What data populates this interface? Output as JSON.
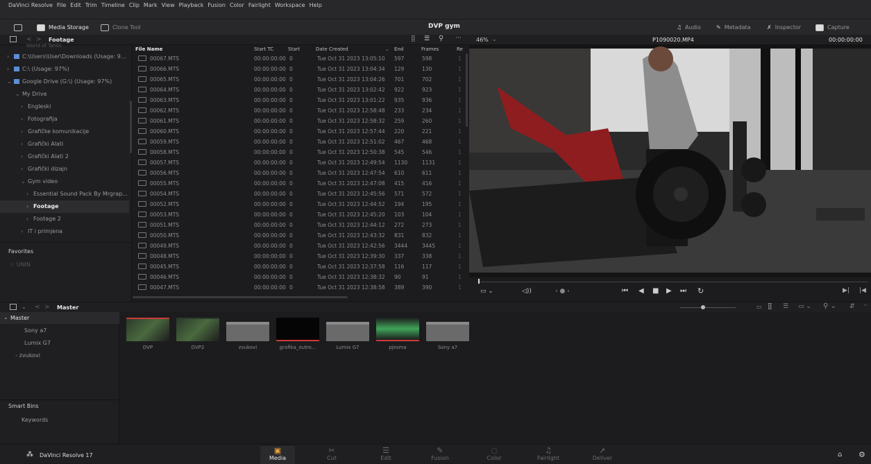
{
  "menu": [
    "DaVinci Resolve",
    "File",
    "Edit",
    "Trim",
    "Timeline",
    "Clip",
    "Mark",
    "View",
    "Playback",
    "Fusion",
    "Color",
    "Fairlight",
    "Workspace",
    "Help"
  ],
  "toolbar": {
    "media_storage": "Media Storage",
    "clone_tool": "Clone Tool",
    "project_title": "DVP gym",
    "audio": "Audio",
    "metadata": "Metadata",
    "inspector": "Inspector",
    "capture": "Capture"
  },
  "storage": {
    "folder": "Footage",
    "zoom": "46%",
    "clip_name": "P1090020.MP4",
    "timecode": "00:00:00:00"
  },
  "tree": {
    "truncated_top": "World of Tanks",
    "items": [
      {
        "label": "C:\\Users\\User\\Downloads (Usage: 9...",
        "drive": true
      },
      {
        "label": "C:\\ (Usage: 97%)",
        "drive": true
      },
      {
        "label": "Google Drive (G:\\) (Usage: 97%)",
        "drive": true
      },
      {
        "label": "My Drive"
      },
      {
        "label": "Engleski"
      },
      {
        "label": "Fotografija"
      },
      {
        "label": "Grafičke komunikacije"
      },
      {
        "label": "Grafički Alati"
      },
      {
        "label": "Grafički Alati 2"
      },
      {
        "label": "Grafički dizajn"
      },
      {
        "label": "Gym video"
      },
      {
        "label": "Essential Sound Pack By Mrgrap..."
      },
      {
        "label": "Footage"
      },
      {
        "label": "Footage 2"
      },
      {
        "label": "IT i primjena"
      }
    ],
    "favorites": "Favorites",
    "fav_item": "UNIN"
  },
  "columns": {
    "name": "File Name",
    "starttc": "Start TC",
    "start": "Start",
    "date": "Date Created",
    "end": "End",
    "frames": "Frames",
    "re": "Re"
  },
  "files": [
    {
      "name": "00067.MTS",
      "tc": "00:00:00:00",
      "start": "0",
      "date": "Tue Oct 31 2023 13:05:10",
      "end": "597",
      "frames": "598"
    },
    {
      "name": "00066.MTS",
      "tc": "00:00:00:00",
      "start": "0",
      "date": "Tue Oct 31 2023 13:04:34",
      "end": "129",
      "frames": "130"
    },
    {
      "name": "00065.MTS",
      "tc": "00:00:00:00",
      "start": "0",
      "date": "Tue Oct 31 2023 13:04:26",
      "end": "701",
      "frames": "702"
    },
    {
      "name": "00064.MTS",
      "tc": "00:00:00:00",
      "start": "0",
      "date": "Tue Oct 31 2023 13:02:42",
      "end": "922",
      "frames": "923"
    },
    {
      "name": "00063.MTS",
      "tc": "00:00:00:00",
      "start": "0",
      "date": "Tue Oct 31 2023 13:01:22",
      "end": "935",
      "frames": "936"
    },
    {
      "name": "00062.MTS",
      "tc": "00:00:00:00",
      "start": "0",
      "date": "Tue Oct 31 2023 12:58:48",
      "end": "233",
      "frames": "234"
    },
    {
      "name": "00061.MTS",
      "tc": "00:00:00:00",
      "start": "0",
      "date": "Tue Oct 31 2023 12:58:32",
      "end": "259",
      "frames": "260"
    },
    {
      "name": "00060.MTS",
      "tc": "00:00:00:00",
      "start": "0",
      "date": "Tue Oct 31 2023 12:57:44",
      "end": "220",
      "frames": "221"
    },
    {
      "name": "00059.MTS",
      "tc": "00:00:00:00",
      "start": "0",
      "date": "Tue Oct 31 2023 12:51:02",
      "end": "467",
      "frames": "468"
    },
    {
      "name": "00058.MTS",
      "tc": "00:00:00:00",
      "start": "0",
      "date": "Tue Oct 31 2023 12:50:38",
      "end": "545",
      "frames": "546"
    },
    {
      "name": "00057.MTS",
      "tc": "00:00:00:00",
      "start": "0",
      "date": "Tue Oct 31 2023 12:49:54",
      "end": "1130",
      "frames": "1131"
    },
    {
      "name": "00056.MTS",
      "tc": "00:00:00:00",
      "start": "0",
      "date": "Tue Oct 31 2023 12:47:54",
      "end": "610",
      "frames": "611"
    },
    {
      "name": "00055.MTS",
      "tc": "00:00:00:00",
      "start": "0",
      "date": "Tue Oct 31 2023 12:47:08",
      "end": "415",
      "frames": "416"
    },
    {
      "name": "00054.MTS",
      "tc": "00:00:00:00",
      "start": "0",
      "date": "Tue Oct 31 2023 12:45:56",
      "end": "571",
      "frames": "572"
    },
    {
      "name": "00052.MTS",
      "tc": "00:00:00:00",
      "start": "0",
      "date": "Tue Oct 31 2023 12:44:52",
      "end": "194",
      "frames": "195"
    },
    {
      "name": "00053.MTS",
      "tc": "00:00:00:00",
      "start": "0",
      "date": "Tue Oct 31 2023 12:45:20",
      "end": "103",
      "frames": "104"
    },
    {
      "name": "00051.MTS",
      "tc": "00:00:00:00",
      "start": "0",
      "date": "Tue Oct 31 2023 12:44:12",
      "end": "272",
      "frames": "273"
    },
    {
      "name": "00050.MTS",
      "tc": "00:00:00:00",
      "start": "0",
      "date": "Tue Oct 31 2023 12:43:32",
      "end": "831",
      "frames": "832"
    },
    {
      "name": "00049.MTS",
      "tc": "00:00:00:00",
      "start": "0",
      "date": "Tue Oct 31 2023 12:42:56",
      "end": "3444",
      "frames": "3445"
    },
    {
      "name": "00048.MTS",
      "tc": "00:00:00:00",
      "start": "0",
      "date": "Tue Oct 31 2023 12:39:30",
      "end": "337",
      "frames": "338"
    },
    {
      "name": "00045.MTS",
      "tc": "00:00:00:00",
      "start": "0",
      "date": "Tue Oct 31 2023 12:37:58",
      "end": "116",
      "frames": "117"
    },
    {
      "name": "00046.MTS",
      "tc": "00:00:00:00",
      "start": "0",
      "date": "Tue Oct 31 2023 12:38:32",
      "end": "90",
      "frames": "91"
    },
    {
      "name": "00047.MTS",
      "tc": "00:00:00:00",
      "start": "0",
      "date": "Tue Oct 31 2023 12:38:58",
      "end": "389",
      "frames": "390"
    }
  ],
  "pool": {
    "title": "Master",
    "bins": [
      "Master",
      "Sony a7",
      "Lumix G7",
      "zvukovi"
    ],
    "smart_bins": "Smart Bins",
    "keywords": "Keywords",
    "clips": [
      {
        "label": "DVP",
        "type": "video"
      },
      {
        "label": "DVP2",
        "type": "video"
      },
      {
        "label": "zvukovi",
        "type": "folder"
      },
      {
        "label": "grafika_outro...",
        "type": "graphic"
      },
      {
        "label": "Lumix G7",
        "type": "folder"
      },
      {
        "label": "pjesma",
        "type": "audio"
      },
      {
        "label": "Sony a7",
        "type": "folder"
      }
    ]
  },
  "pages": [
    {
      "label": "Media",
      "icon": "▣",
      "active": true
    },
    {
      "label": "Cut",
      "icon": "✂"
    },
    {
      "label": "Edit",
      "icon": "☰"
    },
    {
      "label": "Fusion",
      "icon": "✎"
    },
    {
      "label": "Color",
      "icon": "◌"
    },
    {
      "label": "Fairlight",
      "icon": "♫"
    },
    {
      "label": "Deliver",
      "icon": "➚"
    }
  ],
  "app_name": "DaVinci Resolve 17",
  "colors": {
    "accent": "#e8e8e8",
    "drive": "#5b8ed6",
    "clip_red": "#d0393a",
    "wave_green": "#3fa45a"
  }
}
